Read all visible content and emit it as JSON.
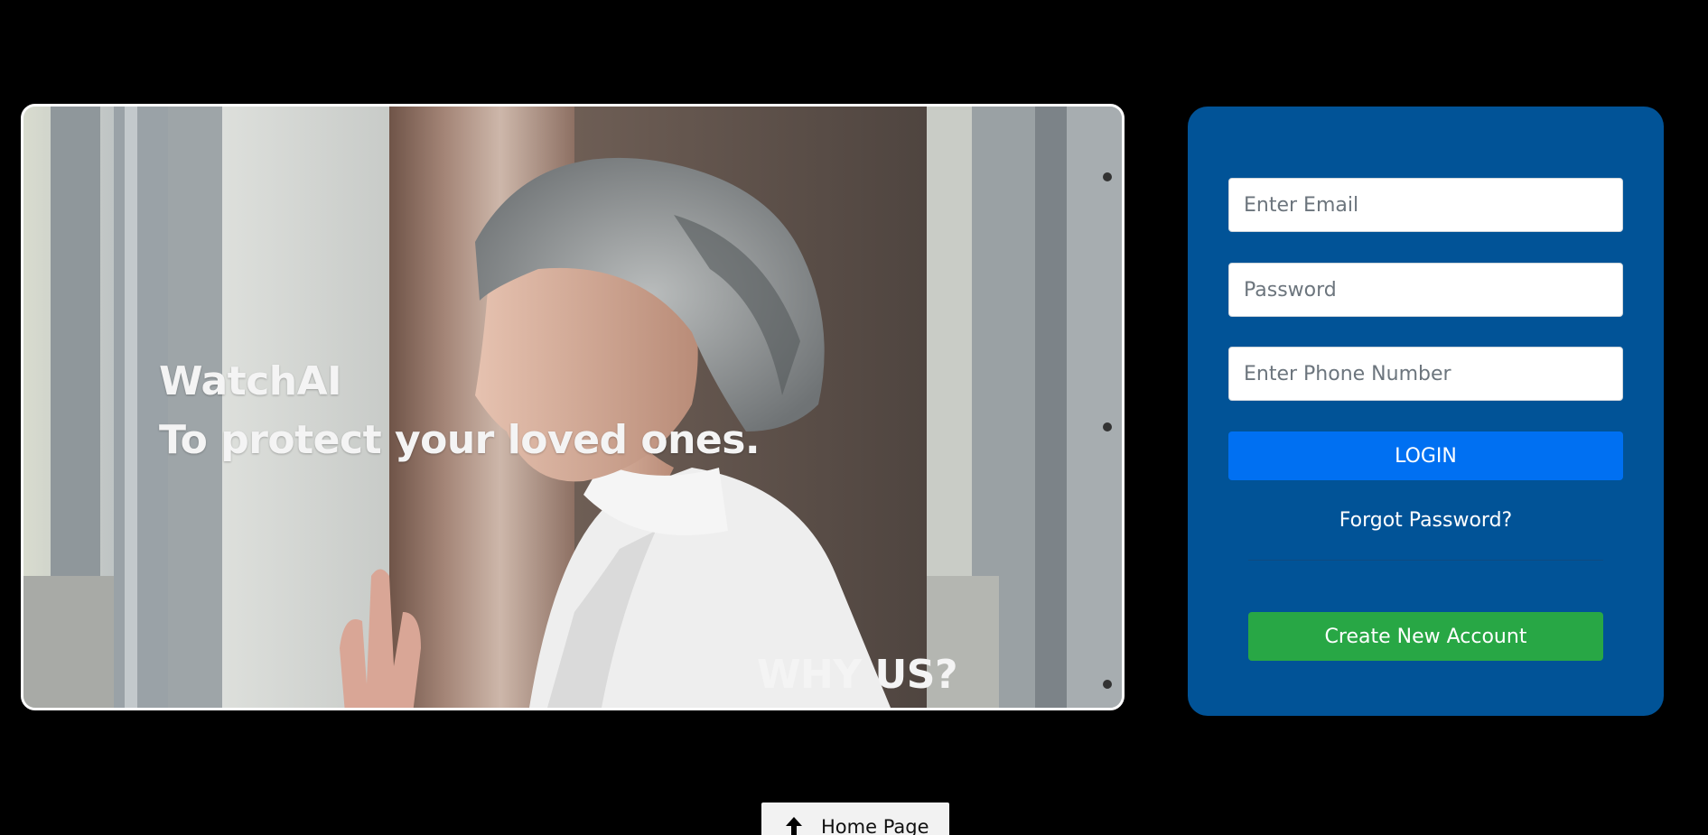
{
  "hero": {
    "brand": "WatchAI",
    "tagline": "To protect your loved ones.",
    "why_us": "WHY US?",
    "photo_icon": "elderly-woman-window-photo"
  },
  "login": {
    "email_placeholder": "Enter Email",
    "password_placeholder": "Password",
    "phone_placeholder": "Enter Phone Number",
    "login_label": "LOGIN",
    "forgot_label": "Forgot Password?",
    "create_label": "Create New Account"
  },
  "footer": {
    "home_label": "Home Page",
    "home_icon": "arrow-up-icon"
  },
  "colors": {
    "background": "#000000",
    "panel": "#015397",
    "login_button": "#0070f2",
    "create_button": "#28a745",
    "home_button": "#f2f2f2"
  }
}
